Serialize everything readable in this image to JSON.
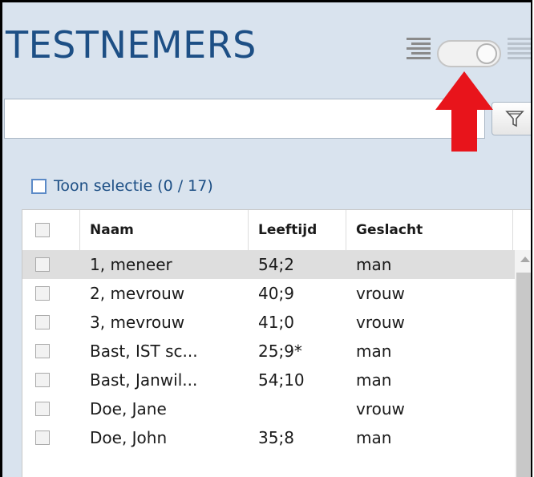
{
  "panel": {
    "title": "TESTNEMERS"
  },
  "view_toggle": {
    "left_icon": "list-lines-icon",
    "right_icon": "list-lines-icon",
    "state": "off"
  },
  "search": {
    "value": "",
    "placeholder": ""
  },
  "filter_button": {
    "icon": "funnel-icon"
  },
  "annotation": {
    "icon": "arrow-up-icon",
    "color": "#e8141b"
  },
  "toon_selectie": {
    "label": "Toon selectie (0 / 17)",
    "checked": false
  },
  "table": {
    "columns": [
      "Naam",
      "Leeftijd",
      "Geslacht"
    ],
    "rows": [
      {
        "naam": "1, meneer",
        "leeftijd": "54;2",
        "geslacht": "man",
        "selected": true
      },
      {
        "naam": "2, mevrouw",
        "leeftijd": "40;9",
        "geslacht": "vrouw",
        "selected": false
      },
      {
        "naam": "3, mevrouw",
        "leeftijd": "41;0",
        "geslacht": "vrouw",
        "selected": false
      },
      {
        "naam": "Bast, IST sc...",
        "leeftijd": "25;9*",
        "geslacht": "man",
        "selected": false
      },
      {
        "naam": "Bast, Janwil...",
        "leeftijd": "54;10",
        "geslacht": "man",
        "selected": false
      },
      {
        "naam": "Doe, Jane",
        "leeftijd": "",
        "geslacht": "vrouw",
        "selected": false
      },
      {
        "naam": "Doe, John",
        "leeftijd": "35;8",
        "geslacht": "man",
        "selected": false
      }
    ]
  },
  "colors": {
    "panel_bg": "#d9e3ee",
    "title": "#1d4f85",
    "selected_row": "#dedede"
  }
}
